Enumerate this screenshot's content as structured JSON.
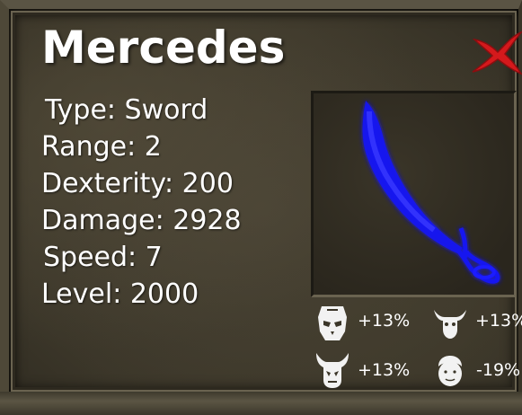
{
  "item": {
    "name": "Mercedes",
    "stats": [
      {
        "label": "Type: Sword"
      },
      {
        "label": "Range: 2"
      },
      {
        "label": "Dexterity: 200"
      },
      {
        "label": "Damage: 2928"
      },
      {
        "label": "Speed: 7"
      },
      {
        "label": "Level: 2000"
      }
    ],
    "image_icon": "blue-curved-sword",
    "glow_color": "#1a1aff"
  },
  "close_icon": "red-x-icon",
  "modifiers": [
    {
      "icon": "skull-mask-icon",
      "value": "+13%"
    },
    {
      "icon": "bull-head-icon",
      "value": "+13%"
    },
    {
      "icon": "horned-demon-icon",
      "value": "+13%"
    },
    {
      "icon": "human-face-icon",
      "value": "-19%"
    }
  ]
}
